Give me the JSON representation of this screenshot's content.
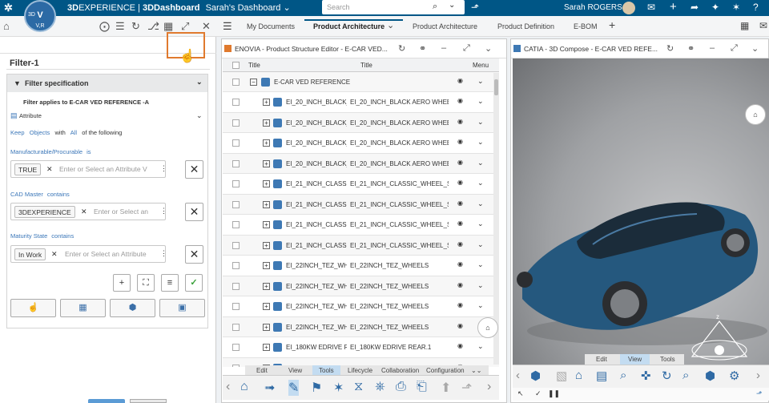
{
  "topbar": {
    "brand_3d": "3D",
    "brand_experience": "EXPERIENCE",
    "brand_sep": " | ",
    "brand_app": "3DDashboard",
    "dashboard_name": "Sarah's Dashboard",
    "search_placeholder": "Search",
    "user_name": "Sarah ROGERS",
    "compass_v": "V",
    "compass_vr": "V,R",
    "compass_3d": "3D"
  },
  "left_panel": {
    "filter_title": "Filter-1",
    "spec_header": "Filter specification",
    "applies_to": "Filter applies to E-CAR VED REFERENCE -A",
    "attribute_label": "Attribute",
    "keep_text": [
      "Keep",
      "Objects",
      "with",
      "All",
      "of the following"
    ],
    "criteria": [
      {
        "label": "Manufacturable/Procurable",
        "operator": "is",
        "chip": "TRUE",
        "placeholder": "Enter or Select an Attribute V"
      },
      {
        "label": "CAD Master",
        "operator": "contains",
        "chip": "3DEXPERIENCE",
        "placeholder": "Enter or Select an"
      },
      {
        "label": "Maturity State",
        "operator": "contains",
        "chip": "In Work",
        "placeholder": "Enter or Select an Attribute"
      }
    ]
  },
  "tabs": [
    "My Documents",
    "Product Architecture",
    "Product Architecture",
    "Product Definition",
    "E-BOM"
  ],
  "structure_widget": {
    "title": "ENOVIA - Product Structure Editor - E-CAR VED...",
    "col_title1": "Title",
    "col_title2": "Title",
    "col_menu": "Menu",
    "root": "E-CAR VED REFERENCE",
    "rows": [
      {
        "c1": "EI_20_INCH_BLACK_AERO_WHEELS",
        "c2": "EI_20_INCH_BLACK AERO WHEELS"
      },
      {
        "c1": "EI_20_INCH_BLACK_AERO_WHEELS",
        "c2": "EI_20_INCH_BLACK AERO WHEELS"
      },
      {
        "c1": "EI_20_INCH_BLACK_AERO_WHEELS",
        "c2": "EI_20_INCH_BLACK AERO WHEELS"
      },
      {
        "c1": "EI_20_INCH_BLACK_AERO_WHEELS",
        "c2": "EI_20_INCH_BLACK AERO WHEELS"
      },
      {
        "c1": "EI_21_INCH_CLASSIC_WHEEL",
        "c2": "EI_21_INCH_CLASSIC_WHEEL_SPORT"
      },
      {
        "c1": "EI_21_INCH_CLASSIC_WHEEL",
        "c2": "EI_21_INCH_CLASSIC_WHEEL_SPORT"
      },
      {
        "c1": "EI_21_INCH_CLASSIC_WHEEL",
        "c2": "EI_21_INCH_CLASSIC_WHEEL_SPORT"
      },
      {
        "c1": "EI_21_INCH_CLASSIC_WHEEL",
        "c2": "EI_21_INCH_CLASSIC_WHEEL_SPORT"
      },
      {
        "c1": "EI_22INCH_TEZ_WHEELS",
        "c2": "EI_22INCH_TEZ_WHEELS"
      },
      {
        "c1": "EI_22INCH_TEZ_WHEELS",
        "c2": "EI_22INCH_TEZ_WHEELS"
      },
      {
        "c1": "EI_22INCH_TEZ_WHEELS",
        "c2": "EI_22INCH_TEZ_WHEELS"
      },
      {
        "c1": "EI_22INCH_TEZ_WHEELS",
        "c2": "EI_22INCH_TEZ_WHEELS"
      },
      {
        "c1": "EI_180KW EDRIVE REAR.1",
        "c2": "EI_180KW EDRIVE REAR.1"
      },
      {
        "c1": "",
        "c2": ""
      }
    ],
    "subtabs": [
      "Edit",
      "View",
      "Tools",
      "Lifecycle",
      "Collaboration",
      "Configuration"
    ]
  },
  "viewer_widget": {
    "title": "CATIA - 3D Compose - E-CAR VED REFE...",
    "subtabs": [
      "Edit",
      "View",
      "Tools"
    ],
    "compass_z": "z"
  },
  "colors": {
    "topbar": "#005686",
    "accent": "#e07a2e",
    "car": "#2a5f86"
  }
}
